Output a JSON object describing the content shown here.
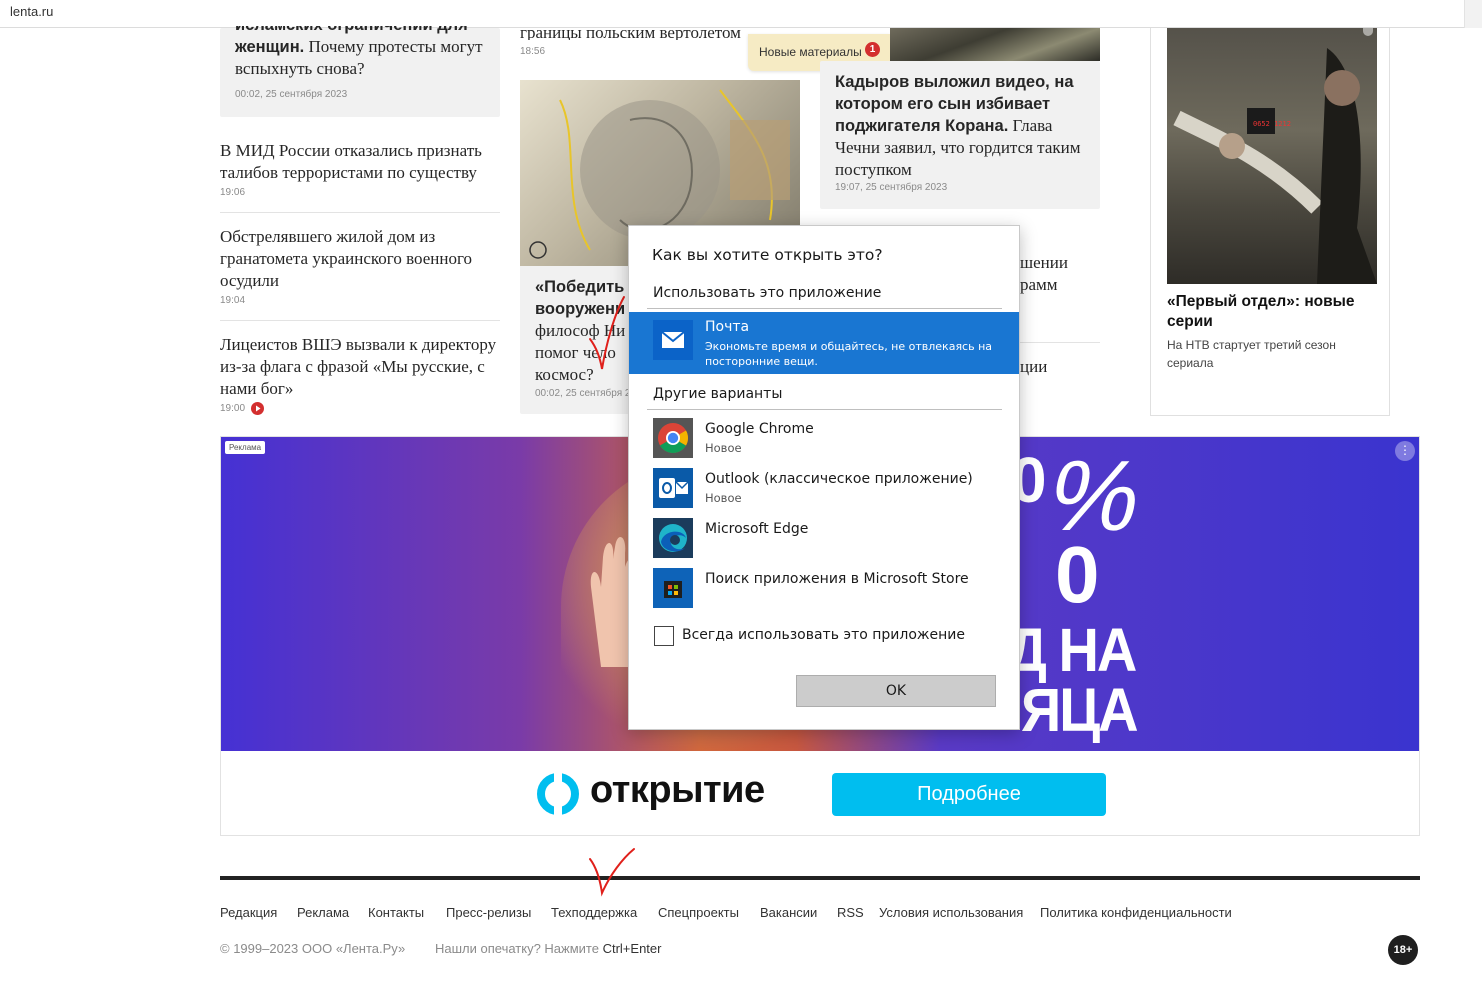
{
  "browser": {
    "url": "lenta.ru"
  },
  "left_column": {
    "card_headline_bold_cut": "исламских ограничений для",
    "card_headline_bold": "женщин.",
    "card_headline_rest": " Почему протесты могут вспыхнуть снова?",
    "card_time": "00:02, 25 сентября 2023",
    "items": [
      {
        "title": "В МИД России отказались признать талибов террористами по существу",
        "time": "19:06"
      },
      {
        "title": "Обстрелявшего жилой дом из гранатомета украинского военного осудили",
        "time": "19:04"
      },
      {
        "title": "Лицеистов ВШЭ вызвали к директору из-за флага с фразой «Мы русские, с нами бог»",
        "time": "19:00"
      }
    ]
  },
  "middle_column": {
    "top_headline_cut": "границы польским вертолетом",
    "top_time": "18:56",
    "card_headline_bold": "«Победить",
    "card_headline_bold2": "вооружени",
    "card_headline_rest1": "философ Ни",
    "card_headline_rest2": "помог чело",
    "card_headline_rest3": "космос?",
    "card_time": "00:02, 25 сентября 2"
  },
  "toast": {
    "label": "Новые материалы",
    "count": "1"
  },
  "right_column": {
    "card_headline_bold": "Кадыров выложил видео, на котором его сын избивает поджигателя Корана.",
    "card_headline_rest": " Глава Чечни заявил, что гордится таким поступком",
    "card_time": "19:07, 25 сентября 2023",
    "item_cut_1": "шении",
    "item_cut_2": "рамм",
    "item_cut_3": "ции"
  },
  "promo": {
    "title": "«Первый отдел»: новые серии",
    "subtitle": "На НТВ стартует третий сезон сериала",
    "image_code": "0652 1212"
  },
  "ad": {
    "label": "Реклама",
    "more_icon": "⋮",
    "text_line1": "0",
    "text_line2": "%",
    "text_line3": "0",
    "text_line4": "Д НА",
    "text_line5": "ЯЦА",
    "brand": "открытие",
    "button": "Подробнее",
    "brand_color": "#00beef"
  },
  "footer": {
    "links": [
      "Редакция",
      "Реклама",
      "Контакты",
      "Пресс-релизы",
      "Техподдержка",
      "Спецпроекты",
      "Вакансии",
      "RSS",
      "Условия использования",
      "Политика конфиденциальности"
    ],
    "copyright": "© 1999–2023 ООО «Лента.Ру»",
    "typo_hint": "Нашли опечатку? Нажмите ",
    "typo_keys": "Ctrl+Enter",
    "age": "18+"
  },
  "dialog": {
    "title": "Как вы хотите открыть это?",
    "use_this_app": "Использовать это приложение",
    "selected_app": {
      "name": "Почта",
      "description": "Экономьте время и общайтесь, не отвлекаясь на посторонние вещи.",
      "icon": "mail-icon"
    },
    "other_options": "Другие варианты",
    "apps": [
      {
        "name": "Google Chrome",
        "sub": "Новое",
        "icon": "chrome-icon"
      },
      {
        "name": "Outlook (классическое приложение)",
        "sub": "Новое",
        "icon": "outlook-icon"
      },
      {
        "name": "Microsoft Edge",
        "sub": "",
        "icon": "edge-icon"
      },
      {
        "name": "Поиск приложения в Microsoft Store",
        "sub": "",
        "icon": "store-icon"
      }
    ],
    "always_use": "Всегда использовать это приложение",
    "always_use_checked": false,
    "ok": "OK",
    "accent": "#1976d2"
  }
}
